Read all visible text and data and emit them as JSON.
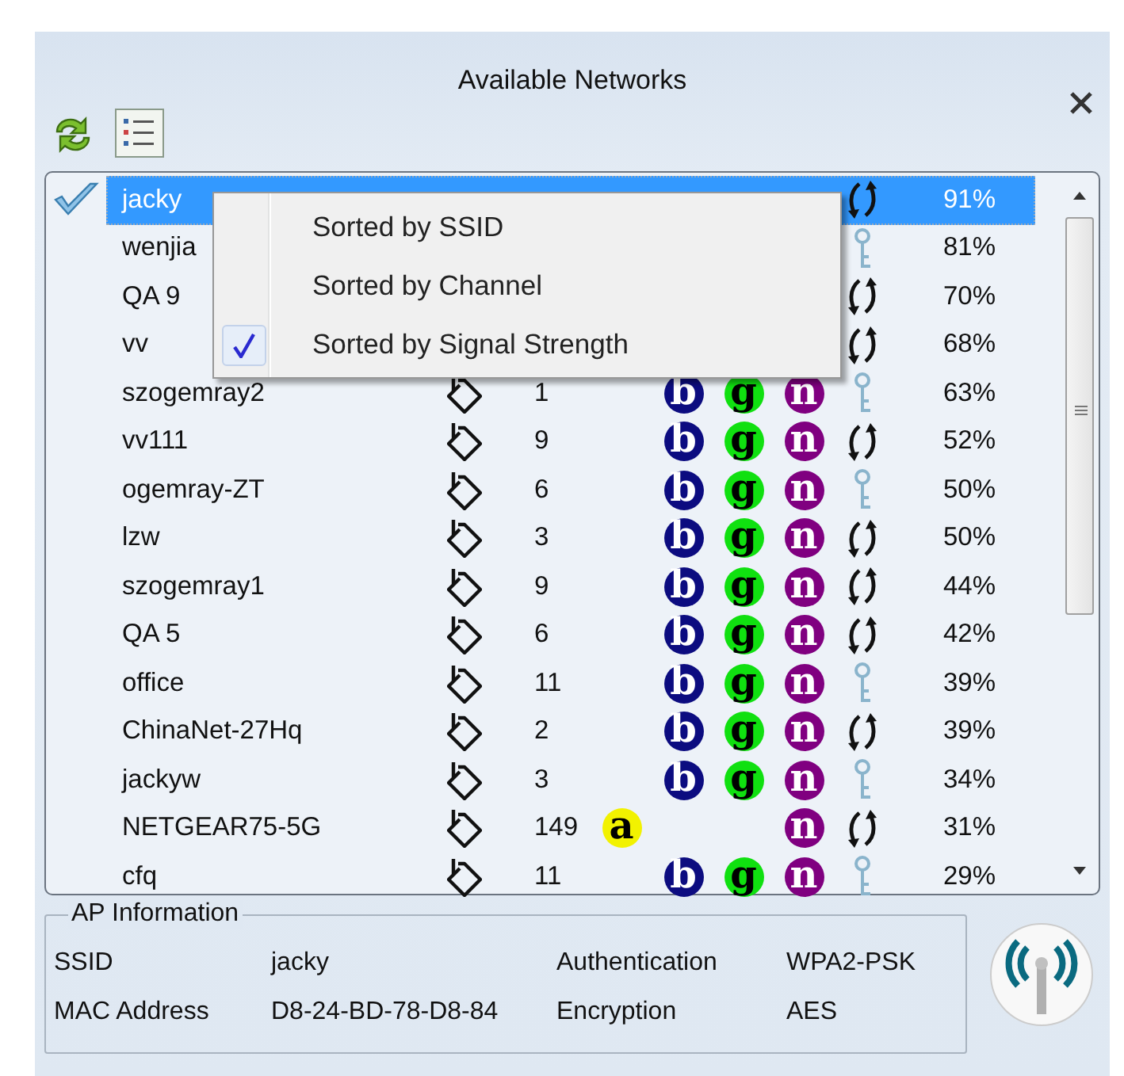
{
  "window": {
    "title": "Available Networks"
  },
  "networks": [
    {
      "ssid": "jacky",
      "connected": true,
      "selected": true,
      "security": {
        "kind": "arrows"
      },
      "signal": "91%"
    },
    {
      "ssid": "wenjia",
      "connected": false,
      "selected": false,
      "security": {
        "kind": "key"
      },
      "signal": "81%"
    },
    {
      "ssid": "QA 9",
      "connected": false,
      "selected": false,
      "security": {
        "kind": "arrows"
      },
      "signal": "70%"
    },
    {
      "ssid": "vv",
      "connected": false,
      "selected": false,
      "security": {
        "kind": "arrows"
      },
      "signal": "68%"
    },
    {
      "ssid": "szogemray2",
      "connected": false,
      "selected": false,
      "channel": "1",
      "bands": [
        {
          "kind": "b",
          "label": "b"
        },
        {
          "kind": "g",
          "label": "g"
        },
        {
          "kind": "n",
          "label": "n"
        }
      ],
      "security": {
        "kind": "key"
      },
      "signal": "63%"
    },
    {
      "ssid": "vv111",
      "connected": false,
      "selected": false,
      "channel": "9",
      "bands": [
        {
          "kind": "b",
          "label": "b"
        },
        {
          "kind": "g",
          "label": "g"
        },
        {
          "kind": "n",
          "label": "n"
        }
      ],
      "security": {
        "kind": "arrows"
      },
      "signal": "52%"
    },
    {
      "ssid": "ogemray-ZT",
      "connected": false,
      "selected": false,
      "channel": "6",
      "bands": [
        {
          "kind": "b",
          "label": "b"
        },
        {
          "kind": "g",
          "label": "g"
        },
        {
          "kind": "n",
          "label": "n"
        }
      ],
      "security": {
        "kind": "key"
      },
      "signal": "50%"
    },
    {
      "ssid": "lzw",
      "connected": false,
      "selected": false,
      "channel": "3",
      "bands": [
        {
          "kind": "b",
          "label": "b"
        },
        {
          "kind": "g",
          "label": "g"
        },
        {
          "kind": "n",
          "label": "n"
        }
      ],
      "security": {
        "kind": "arrows"
      },
      "signal": "50%"
    },
    {
      "ssid": "szogemray1",
      "connected": false,
      "selected": false,
      "channel": "9",
      "bands": [
        {
          "kind": "b",
          "label": "b"
        },
        {
          "kind": "g",
          "label": "g"
        },
        {
          "kind": "n",
          "label": "n"
        }
      ],
      "security": {
        "kind": "arrows"
      },
      "signal": "44%"
    },
    {
      "ssid": "QA 5",
      "connected": false,
      "selected": false,
      "channel": "6",
      "bands": [
        {
          "kind": "b",
          "label": "b"
        },
        {
          "kind": "g",
          "label": "g"
        },
        {
          "kind": "n",
          "label": "n"
        }
      ],
      "security": {
        "kind": "arrows"
      },
      "signal": "42%"
    },
    {
      "ssid": "office",
      "connected": false,
      "selected": false,
      "channel": "11",
      "bands": [
        {
          "kind": "b",
          "label": "b"
        },
        {
          "kind": "g",
          "label": "g"
        },
        {
          "kind": "n",
          "label": "n"
        }
      ],
      "security": {
        "kind": "key"
      },
      "signal": "39%"
    },
    {
      "ssid": "ChinaNet-27Hq",
      "connected": false,
      "selected": false,
      "channel": "2",
      "bands": [
        {
          "kind": "b",
          "label": "b"
        },
        {
          "kind": "g",
          "label": "g"
        },
        {
          "kind": "n",
          "label": "n"
        }
      ],
      "security": {
        "kind": "arrows"
      },
      "signal": "39%"
    },
    {
      "ssid": "jackyw",
      "connected": false,
      "selected": false,
      "channel": "3",
      "bands": [
        {
          "kind": "b",
          "label": "b"
        },
        {
          "kind": "g",
          "label": "g"
        },
        {
          "kind": "n",
          "label": "n"
        }
      ],
      "security": {
        "kind": "key"
      },
      "signal": "34%"
    },
    {
      "ssid": "NETGEAR75-5G",
      "connected": false,
      "selected": false,
      "channel": "149",
      "bands": [
        {
          "kind": "a",
          "label": "a"
        },
        {
          "kind": "n",
          "label": "n"
        }
      ],
      "security": {
        "kind": "arrows"
      },
      "signal": "31%"
    },
    {
      "ssid": "cfq",
      "connected": false,
      "selected": false,
      "channel": "11",
      "bands": [
        {
          "kind": "b",
          "label": "b"
        },
        {
          "kind": "g",
          "label": "g"
        },
        {
          "kind": "n",
          "label": "n"
        }
      ],
      "security": {
        "kind": "key"
      },
      "signal": "29%"
    }
  ],
  "sort_menu": [
    {
      "label": "Sorted by SSID",
      "checked": false
    },
    {
      "label": "Sorted by Channel",
      "checked": false
    },
    {
      "label": "Sorted by Signal Strength",
      "checked": true
    }
  ],
  "ap_info": {
    "title": "AP Information",
    "fields": [
      {
        "label": "SSID",
        "value": "jacky"
      },
      {
        "label": "Authentication",
        "value": "WPA2-PSK"
      },
      {
        "label": "MAC Address",
        "value": "D8-24-BD-78-D8-84"
      },
      {
        "label": "Encryption",
        "value": "AES"
      }
    ]
  }
}
